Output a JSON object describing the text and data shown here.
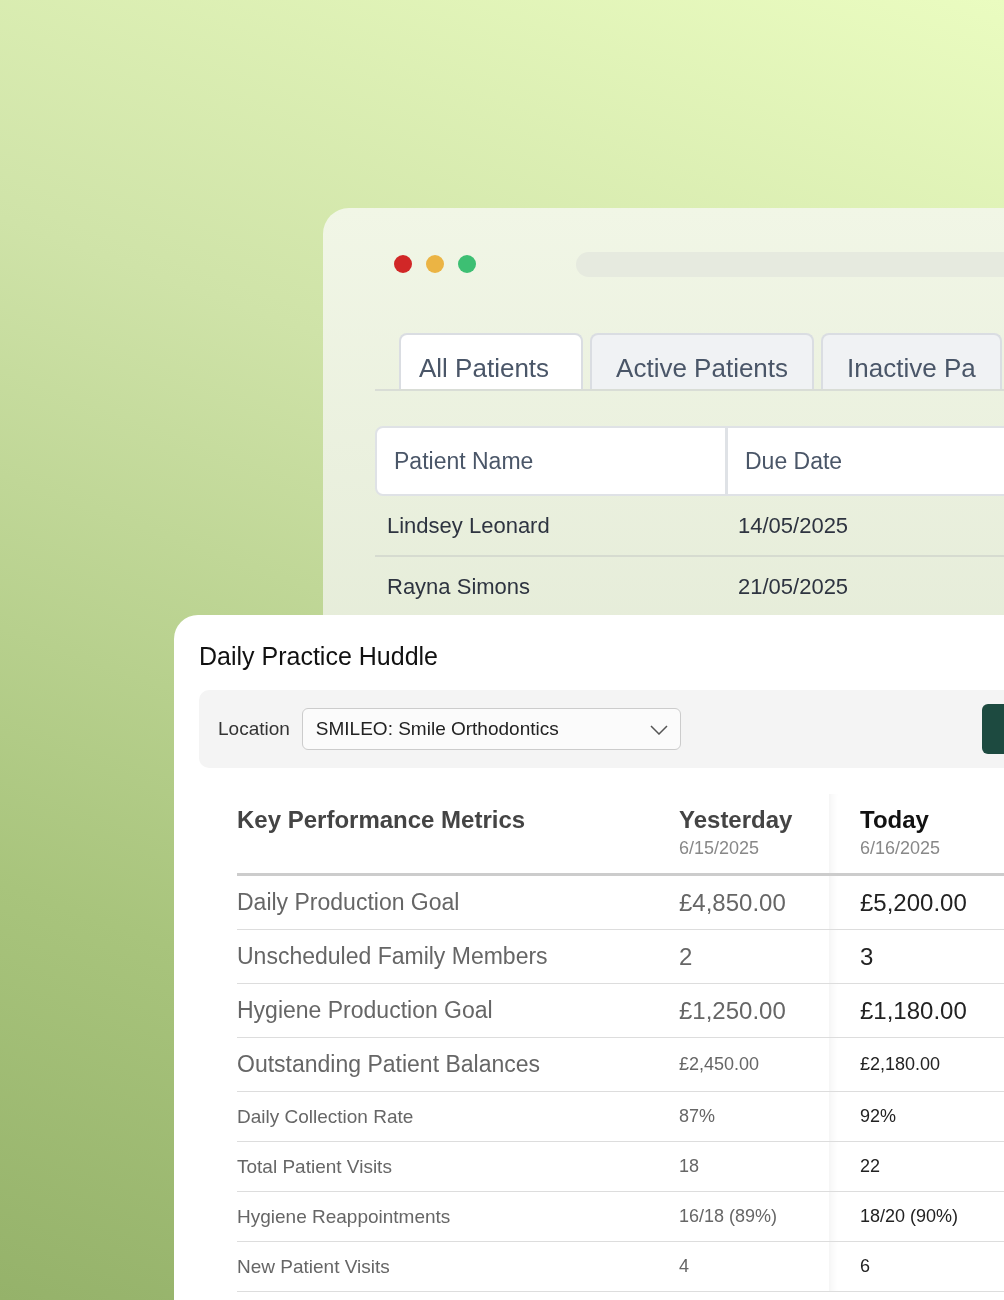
{
  "back_window": {
    "tabs": [
      {
        "label": "All Patients",
        "selected": true
      },
      {
        "label": "Active Patients",
        "selected": false
      },
      {
        "label": "Inactive Pa",
        "selected": false
      }
    ],
    "table": {
      "columns": [
        "Patient Name",
        "Due Date"
      ],
      "rows": [
        {
          "patient_name": "Lindsey Leonard",
          "due_date": "14/05/2025"
        },
        {
          "patient_name": "Rayna Simons",
          "due_date": "21/05/2025"
        }
      ]
    }
  },
  "huddle": {
    "title": "Daily Practice Huddle",
    "location_label": "Location",
    "location_value": "SMILEO:  Smile Orthodontics",
    "metrics": {
      "heading": "Key Performance Metrics",
      "yesterday": {
        "label": "Yesterday",
        "date": "6/15/2025"
      },
      "today": {
        "label": "Today",
        "date": "6/16/2025"
      },
      "rows": [
        {
          "kind": "large",
          "metric": "Daily Production Goal",
          "yesterday": "£4,850.00",
          "today": "£5,200.00"
        },
        {
          "kind": "large",
          "metric": "Unscheduled Family Members",
          "yesterday": "2",
          "today": "3"
        },
        {
          "kind": "large",
          "metric": "Hygiene Production Goal",
          "yesterday": "£1,250.00",
          "today": "£1,180.00"
        },
        {
          "kind": "mixed",
          "metric": "Outstanding Patient Balances",
          "yesterday": "£2,450.00",
          "today": "£2,180.00"
        },
        {
          "kind": "small",
          "metric": "Daily Collection Rate",
          "yesterday": "87%",
          "today": "92%"
        },
        {
          "kind": "small",
          "metric": "Total Patient Visits",
          "yesterday": "18",
          "today": "22"
        },
        {
          "kind": "small",
          "metric": "Hygiene Reappointments",
          "yesterday": "16/18 (89%)",
          "today": "18/20 (90%)"
        },
        {
          "kind": "small",
          "metric": "New Patient Visits",
          "yesterday": "4",
          "today": "6"
        }
      ]
    }
  }
}
